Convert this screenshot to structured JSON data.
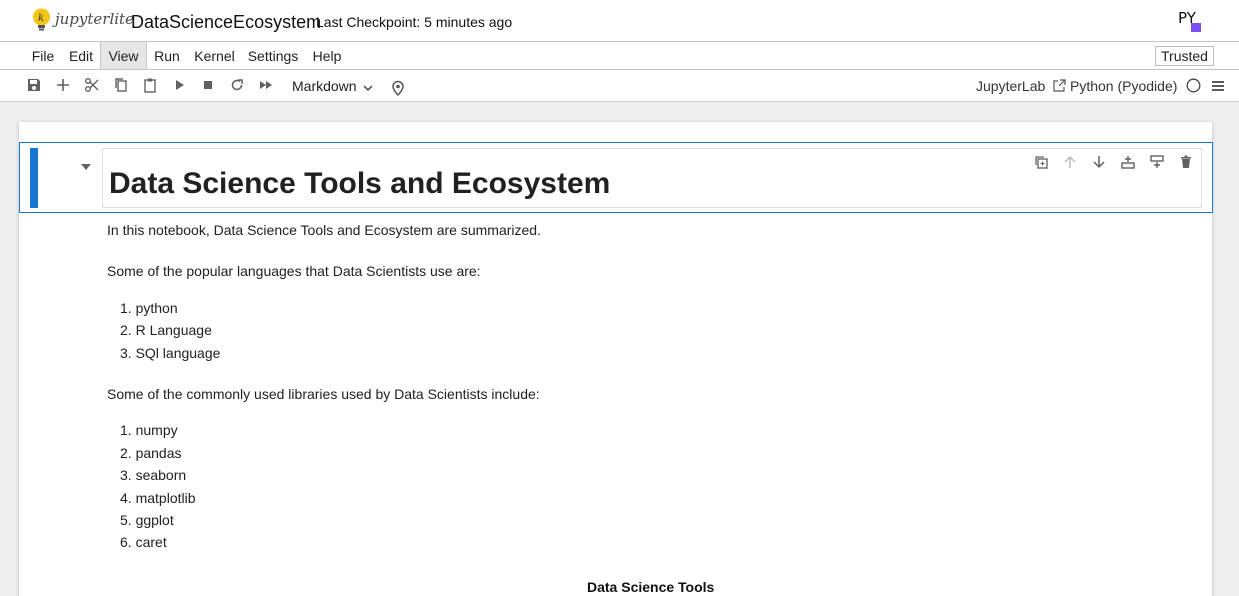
{
  "header": {
    "logo_text": "jupyterlite",
    "notebook_title": "DataScienceEcosystem",
    "checkpoint": "Last Checkpoint: 5 minutes ago",
    "kernel_logo_text": "PY"
  },
  "menu": {
    "items": [
      "File",
      "Edit",
      "View",
      "Run",
      "Kernel",
      "Settings",
      "Help"
    ],
    "active": "View",
    "trusted": "Trusted"
  },
  "toolbar": {
    "icons": [
      "save-icon",
      "add-cell-icon",
      "cut-icon",
      "copy-icon",
      "paste-icon",
      "run-icon",
      "stop-icon",
      "restart-icon",
      "run-all-icon",
      "debug-pin-icon"
    ],
    "cell_type": "Markdown",
    "jupyterlab_link": "JupyterLab",
    "kernel_name": "Python (Pyodide)"
  },
  "cell": {
    "heading": "Data Science Tools and Ecosystem",
    "tools": [
      "duplicate-icon",
      "move-up-icon",
      "move-down-icon",
      "insert-above-icon",
      "insert-below-icon",
      "delete-icon"
    ]
  },
  "content": {
    "intro": "In this notebook, Data Science Tools and Ecosystem are summarized.",
    "languages_intro": "Some of the popular languages that Data Scientists use are:",
    "languages": [
      "python",
      "R Language",
      "SQl language"
    ],
    "libraries_intro": "Some of the commonly used libraries used by Data Scientists include:",
    "libraries": [
      "numpy",
      "pandas",
      "seaborn",
      "matplotlib",
      "ggplot",
      "caret"
    ],
    "tools_table_heading": "Data Science Tools"
  },
  "colors": {
    "accent": "#1976d2",
    "logo_yellow": "#f5c518",
    "pyodide_purple": "#7b4ff5"
  }
}
